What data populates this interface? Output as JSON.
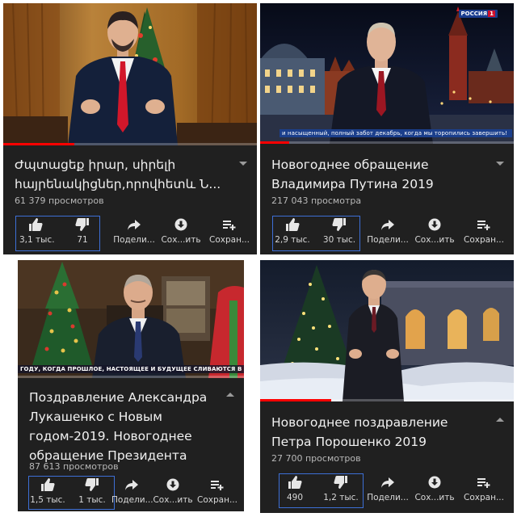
{
  "panels": [
    {
      "title": "Ժպտացեք իրար, սիրելի հայրենակիցներ,որովհետև Ն...",
      "views": "61 379 просмотров",
      "likes": "3,1 тыс.",
      "dislikes": "71",
      "share": "Подели...",
      "save": "Сох...ить",
      "save_to": "Сохран...",
      "menu_chevron": "down"
    },
    {
      "title": "Новогоднее обращение Владимира Путина 2019",
      "views": "217 043 просмотра",
      "likes": "2,9 тыс.",
      "dislikes": "30 тыс.",
      "share": "Подели...",
      "save": "Сох...ить",
      "save_to": "Сохран...",
      "channel_logo": "РОССИЯ",
      "channel_logo_num": "1",
      "caption": "и насыщенный, полный забот декабрь, когда мы торопились завершить!",
      "menu_chevron": "down"
    },
    {
      "title": "Поздравление Александра Лукашенко с Новым годом-2019. Новогоднее обращение Президента",
      "views": "87 613 просмотров",
      "likes": "1,5 тыс.",
      "dislikes": "1 тыс.",
      "share": "Подели...",
      "save": "Сох...ить",
      "save_to": "Сохран...",
      "caption": "ГОДУ, КОГДА ПРОШЛОЕ, НАСТОЯЩЕЕ И БУДУЩЕЕ СЛИВАЮТСЯ В ОДНО М",
      "menu_chevron": "up"
    },
    {
      "title": "Новогоднее поздравление Петра Порошенко 2019",
      "views": "27 700 просмотров",
      "likes": "490",
      "dislikes": "1,2 тыс.",
      "share": "Подели...",
      "save": "Сох...ить",
      "save_to": "Сохран...",
      "menu_chevron": "up"
    }
  ],
  "colors": {
    "panel_bg": "#202020",
    "progress": "#ff0000",
    "highlight_box": "#3d6fd6",
    "title_text": "#f1f1f1",
    "meta_text": "#b8b8b8"
  },
  "icons": [
    "thumb-up-icon",
    "thumb-down-icon",
    "share-icon",
    "download-icon",
    "playlist-add-icon",
    "chevron-icon"
  ]
}
